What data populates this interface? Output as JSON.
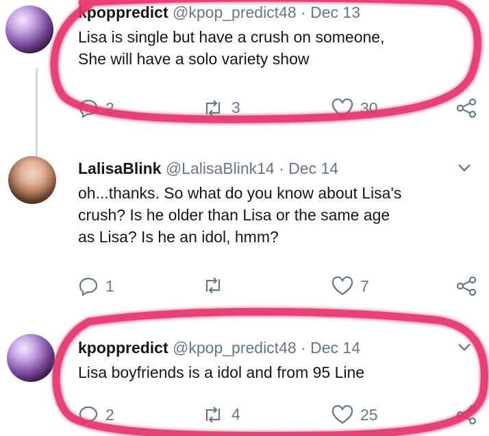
{
  "tweets": [
    {
      "name": "kpoppredict",
      "handle": "@kpop_predict48",
      "sep": "·",
      "date": "Dec 13",
      "lines": [
        "Lisa is single but have a crush on someone,",
        "She will have a solo variety show"
      ],
      "replies": "2",
      "retweets": "3",
      "likes": "30"
    },
    {
      "name": "LalisaBlink",
      "handle": "@LalisaBlink14",
      "sep": "·",
      "date": "Dec 14",
      "lines": [
        "oh...thanks. So what do you know about Lisa's",
        "crush? Is he older than Lisa or the same age",
        "as Lisa? Is he an idol, hmm?"
      ],
      "replies": "1",
      "retweets": "",
      "likes": "7"
    },
    {
      "name": "kpoppredict",
      "handle": "@kpop_predict48",
      "sep": "·",
      "date": "Dec 14",
      "lines": [
        "Lisa boyfriends is a idol and from 95 Line"
      ],
      "replies": "2",
      "retweets": "4",
      "likes": "25"
    }
  ],
  "colors": {
    "highlight": "#e5336b",
    "muted": "#657786",
    "text": "#14171a"
  }
}
